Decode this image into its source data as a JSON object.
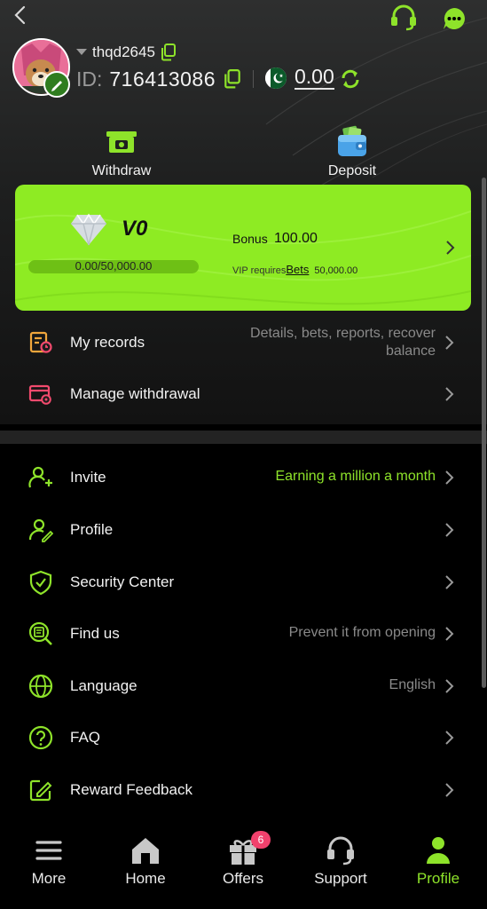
{
  "user": {
    "username": "thqd2645",
    "id_label": "ID:",
    "id_value": "716413086",
    "balance": "0.00"
  },
  "actions": {
    "withdraw_label": "Withdraw",
    "deposit_label": "Deposit"
  },
  "vip": {
    "level": "V0",
    "progress_text": "0.00/50,000.00",
    "progress_fraction": 0,
    "bonus_label": "Bonus",
    "bonus_value": "100.00",
    "requires_label": "VIP requires",
    "requires_link": "Bets",
    "requires_amount": "50,000.00"
  },
  "menu_top": [
    {
      "label": "My records",
      "value_line1": "Details, bets, reports, recover",
      "value_line2": "balance"
    },
    {
      "label": "Manage withdrawal",
      "value_line1": ""
    }
  ],
  "menu": [
    {
      "label": "Invite",
      "value": "Earning a million a month",
      "icon": "invite-icon"
    },
    {
      "label": "Profile",
      "value": "",
      "icon": "profile-icon"
    },
    {
      "label": "Security Center",
      "value": "",
      "icon": "shield-icon"
    },
    {
      "label": "Find us",
      "value": "Prevent it from opening",
      "icon": "find-us-icon"
    },
    {
      "label": "Language",
      "value": "English",
      "icon": "globe-icon"
    },
    {
      "label": "FAQ",
      "value": "",
      "icon": "question-icon"
    },
    {
      "label": "Reward Feedback",
      "value": "",
      "icon": "edit-icon"
    }
  ],
  "nav": {
    "more": "More",
    "home": "Home",
    "offers": "Offers",
    "offers_badge": "6",
    "support": "Support",
    "profile": "Profile"
  },
  "colors": {
    "accent": "#8ee32a",
    "vip_card": "#8eeb23",
    "badge": "#f2416d",
    "background": "#000000"
  }
}
